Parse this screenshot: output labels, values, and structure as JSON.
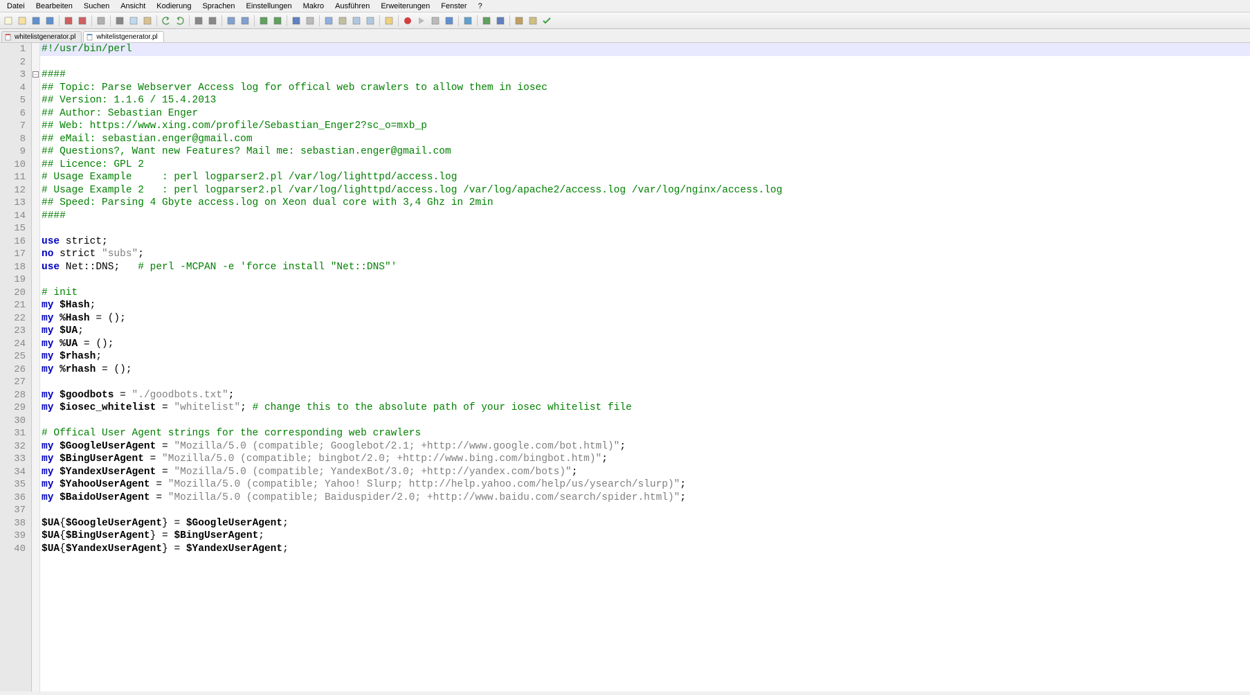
{
  "menus": [
    "Datei",
    "Bearbeiten",
    "Suchen",
    "Ansicht",
    "Kodierung",
    "Sprachen",
    "Einstellungen",
    "Makro",
    "Ausführen",
    "Erweiterungen",
    "Fenster",
    "?"
  ],
  "tabs": [
    {
      "name": "whitelistgenerator.pl",
      "active": false
    },
    {
      "name": "whitelistgenerator.pl",
      "active": true
    }
  ],
  "line_count": 40,
  "fold_line": 3,
  "current_line": 1,
  "code": [
    {
      "segments": [
        {
          "t": "#!/usr/bin/perl",
          "c": "comment"
        }
      ]
    },
    {
      "segments": []
    },
    {
      "segments": [
        {
          "t": "####",
          "c": "comment"
        }
      ]
    },
    {
      "segments": [
        {
          "t": "## Topic: Parse Webserver Access log for offical web crawlers to allow them in iosec",
          "c": "comment"
        }
      ]
    },
    {
      "segments": [
        {
          "t": "## Version: 1.1.6 / 15.4.2013",
          "c": "comment"
        }
      ]
    },
    {
      "segments": [
        {
          "t": "## Author: Sebastian Enger",
          "c": "comment"
        }
      ]
    },
    {
      "segments": [
        {
          "t": "## Web: https://www.xing.com/profile/Sebastian_Enger2?sc_o=mxb_p",
          "c": "comment"
        }
      ]
    },
    {
      "segments": [
        {
          "t": "## eMail: sebastian.enger@gmail.com",
          "c": "comment"
        }
      ]
    },
    {
      "segments": [
        {
          "t": "## Questions?, Want new Features? Mail me: sebastian.enger@gmail.com",
          "c": "comment"
        }
      ]
    },
    {
      "segments": [
        {
          "t": "## Licence: GPL 2",
          "c": "comment"
        }
      ]
    },
    {
      "segments": [
        {
          "t": "# Usage Example     : perl logparser2.pl /var/log/lighttpd/access.log",
          "c": "comment"
        }
      ]
    },
    {
      "segments": [
        {
          "t": "# Usage Example 2   : perl logparser2.pl /var/log/lighttpd/access.log /var/log/apache2/access.log /var/log/nginx/access.log",
          "c": "comment"
        }
      ]
    },
    {
      "segments": [
        {
          "t": "## Speed: Parsing 4 Gbyte access.log on Xeon dual core with 3,4 Ghz in 2min",
          "c": "comment"
        }
      ]
    },
    {
      "segments": [
        {
          "t": "####",
          "c": "comment"
        }
      ]
    },
    {
      "segments": []
    },
    {
      "segments": [
        {
          "t": "use",
          "c": "keyword"
        },
        {
          "t": " strict",
          "c": "ident"
        },
        {
          "t": ";",
          "c": "punct"
        }
      ]
    },
    {
      "segments": [
        {
          "t": "no",
          "c": "keyword"
        },
        {
          "t": " strict ",
          "c": "ident"
        },
        {
          "t": "\"subs\"",
          "c": "string"
        },
        {
          "t": ";",
          "c": "punct"
        }
      ]
    },
    {
      "segments": [
        {
          "t": "use",
          "c": "keyword"
        },
        {
          "t": " Net::DNS",
          "c": "ident"
        },
        {
          "t": ";   ",
          "c": "punct"
        },
        {
          "t": "# perl -MCPAN -e 'force install \"Net::DNS\"'",
          "c": "comment"
        }
      ]
    },
    {
      "segments": []
    },
    {
      "segments": [
        {
          "t": "# init",
          "c": "comment"
        }
      ]
    },
    {
      "segments": [
        {
          "t": "my",
          "c": "keyword"
        },
        {
          "t": " ",
          "c": "ident"
        },
        {
          "t": "$Hash",
          "c": "var"
        },
        {
          "t": ";",
          "c": "punct"
        }
      ]
    },
    {
      "segments": [
        {
          "t": "my",
          "c": "keyword"
        },
        {
          "t": " ",
          "c": "ident"
        },
        {
          "t": "%Hash",
          "c": "var"
        },
        {
          "t": " = ();",
          "c": "punct"
        }
      ]
    },
    {
      "segments": [
        {
          "t": "my",
          "c": "keyword"
        },
        {
          "t": " ",
          "c": "ident"
        },
        {
          "t": "$UA",
          "c": "var"
        },
        {
          "t": ";",
          "c": "punct"
        }
      ]
    },
    {
      "segments": [
        {
          "t": "my",
          "c": "keyword"
        },
        {
          "t": " ",
          "c": "ident"
        },
        {
          "t": "%UA",
          "c": "var"
        },
        {
          "t": " = ();",
          "c": "punct"
        }
      ]
    },
    {
      "segments": [
        {
          "t": "my",
          "c": "keyword"
        },
        {
          "t": " ",
          "c": "ident"
        },
        {
          "t": "$rhash",
          "c": "var"
        },
        {
          "t": ";",
          "c": "punct"
        }
      ]
    },
    {
      "segments": [
        {
          "t": "my",
          "c": "keyword"
        },
        {
          "t": " ",
          "c": "ident"
        },
        {
          "t": "%rhash",
          "c": "var"
        },
        {
          "t": " = ();",
          "c": "punct"
        }
      ]
    },
    {
      "segments": []
    },
    {
      "segments": [
        {
          "t": "my",
          "c": "keyword"
        },
        {
          "t": " ",
          "c": "ident"
        },
        {
          "t": "$goodbots",
          "c": "var"
        },
        {
          "t": " = ",
          "c": "punct"
        },
        {
          "t": "\"./goodbots.txt\"",
          "c": "string"
        },
        {
          "t": ";",
          "c": "punct"
        }
      ]
    },
    {
      "segments": [
        {
          "t": "my",
          "c": "keyword"
        },
        {
          "t": " ",
          "c": "ident"
        },
        {
          "t": "$iosec_whitelist",
          "c": "var"
        },
        {
          "t": " = ",
          "c": "punct"
        },
        {
          "t": "\"whitelist\"",
          "c": "string"
        },
        {
          "t": "; ",
          "c": "punct"
        },
        {
          "t": "# change this to the absolute path of your iosec whitelist file",
          "c": "comment"
        }
      ]
    },
    {
      "segments": []
    },
    {
      "segments": [
        {
          "t": "# Offical User Agent strings for the corresponding web crawlers",
          "c": "comment"
        }
      ]
    },
    {
      "segments": [
        {
          "t": "my",
          "c": "keyword"
        },
        {
          "t": " ",
          "c": "ident"
        },
        {
          "t": "$GoogleUserAgent",
          "c": "var"
        },
        {
          "t": " = ",
          "c": "punct"
        },
        {
          "t": "\"Mozilla/5.0 (compatible; Googlebot/2.1; +http://www.google.com/bot.html)\"",
          "c": "string"
        },
        {
          "t": ";",
          "c": "punct"
        }
      ]
    },
    {
      "segments": [
        {
          "t": "my",
          "c": "keyword"
        },
        {
          "t": " ",
          "c": "ident"
        },
        {
          "t": "$BingUserAgent",
          "c": "var"
        },
        {
          "t": " = ",
          "c": "punct"
        },
        {
          "t": "\"Mozilla/5.0 (compatible; bingbot/2.0; +http://www.bing.com/bingbot.htm)\"",
          "c": "string"
        },
        {
          "t": ";",
          "c": "punct"
        }
      ]
    },
    {
      "segments": [
        {
          "t": "my",
          "c": "keyword"
        },
        {
          "t": " ",
          "c": "ident"
        },
        {
          "t": "$YandexUserAgent",
          "c": "var"
        },
        {
          "t": " = ",
          "c": "punct"
        },
        {
          "t": "\"Mozilla/5.0 (compatible; YandexBot/3.0; +http://yandex.com/bots)\"",
          "c": "string"
        },
        {
          "t": ";",
          "c": "punct"
        }
      ]
    },
    {
      "segments": [
        {
          "t": "my",
          "c": "keyword"
        },
        {
          "t": " ",
          "c": "ident"
        },
        {
          "t": "$YahooUserAgent",
          "c": "var"
        },
        {
          "t": " = ",
          "c": "punct"
        },
        {
          "t": "\"Mozilla/5.0 (compatible; Yahoo! Slurp; http://help.yahoo.com/help/us/ysearch/slurp)\"",
          "c": "string"
        },
        {
          "t": ";",
          "c": "punct"
        }
      ]
    },
    {
      "segments": [
        {
          "t": "my",
          "c": "keyword"
        },
        {
          "t": " ",
          "c": "ident"
        },
        {
          "t": "$BaidoUserAgent",
          "c": "var"
        },
        {
          "t": " = ",
          "c": "punct"
        },
        {
          "t": "\"Mozilla/5.0 (compatible; Baiduspider/2.0; +http://www.baidu.com/search/spider.html)\"",
          "c": "string"
        },
        {
          "t": ";",
          "c": "punct"
        }
      ]
    },
    {
      "segments": []
    },
    {
      "segments": [
        {
          "t": "$UA",
          "c": "var"
        },
        {
          "t": "{",
          "c": "punct"
        },
        {
          "t": "$GoogleUserAgent",
          "c": "var"
        },
        {
          "t": "} = ",
          "c": "punct"
        },
        {
          "t": "$GoogleUserAgent",
          "c": "var"
        },
        {
          "t": ";",
          "c": "punct"
        }
      ]
    },
    {
      "segments": [
        {
          "t": "$UA",
          "c": "var"
        },
        {
          "t": "{",
          "c": "punct"
        },
        {
          "t": "$BingUserAgent",
          "c": "var"
        },
        {
          "t": "} = ",
          "c": "punct"
        },
        {
          "t": "$BingUserAgent",
          "c": "var"
        },
        {
          "t": ";",
          "c": "punct"
        }
      ]
    },
    {
      "segments": [
        {
          "t": "$UA",
          "c": "var"
        },
        {
          "t": "{",
          "c": "punct"
        },
        {
          "t": "$YandexUserAgent",
          "c": "var"
        },
        {
          "t": "} = ",
          "c": "punct"
        },
        {
          "t": "$YandexUserAgent",
          "c": "var"
        },
        {
          "t": ";",
          "c": "punct"
        }
      ]
    }
  ],
  "toolbar_icons": [
    "new-icon",
    "open-icon",
    "save-icon",
    "save-all-icon",
    "sep",
    "close-icon",
    "close-all-icon",
    "sep",
    "print-icon",
    "sep",
    "cut-icon",
    "copy-icon",
    "paste-icon",
    "sep",
    "undo-icon",
    "redo-icon",
    "sep",
    "find-icon",
    "replace-icon",
    "sep",
    "zoom-in-icon",
    "zoom-out-icon",
    "sep",
    "sync-v-icon",
    "sync-h-icon",
    "sep",
    "wordwrap-icon",
    "show-all-icon",
    "sep",
    "indent-guide-icon",
    "lang-icon",
    "doc-map-icon",
    "func-list-icon",
    "sep",
    "folder-icon",
    "sep",
    "record-icon",
    "play-icon",
    "play-multi-icon",
    "save-macro-icon",
    "sep",
    "indent-right-icon",
    "sep",
    "outdent-icon",
    "indent-icon",
    "sep",
    "comment-icon",
    "misc-icon",
    "check-icon"
  ]
}
